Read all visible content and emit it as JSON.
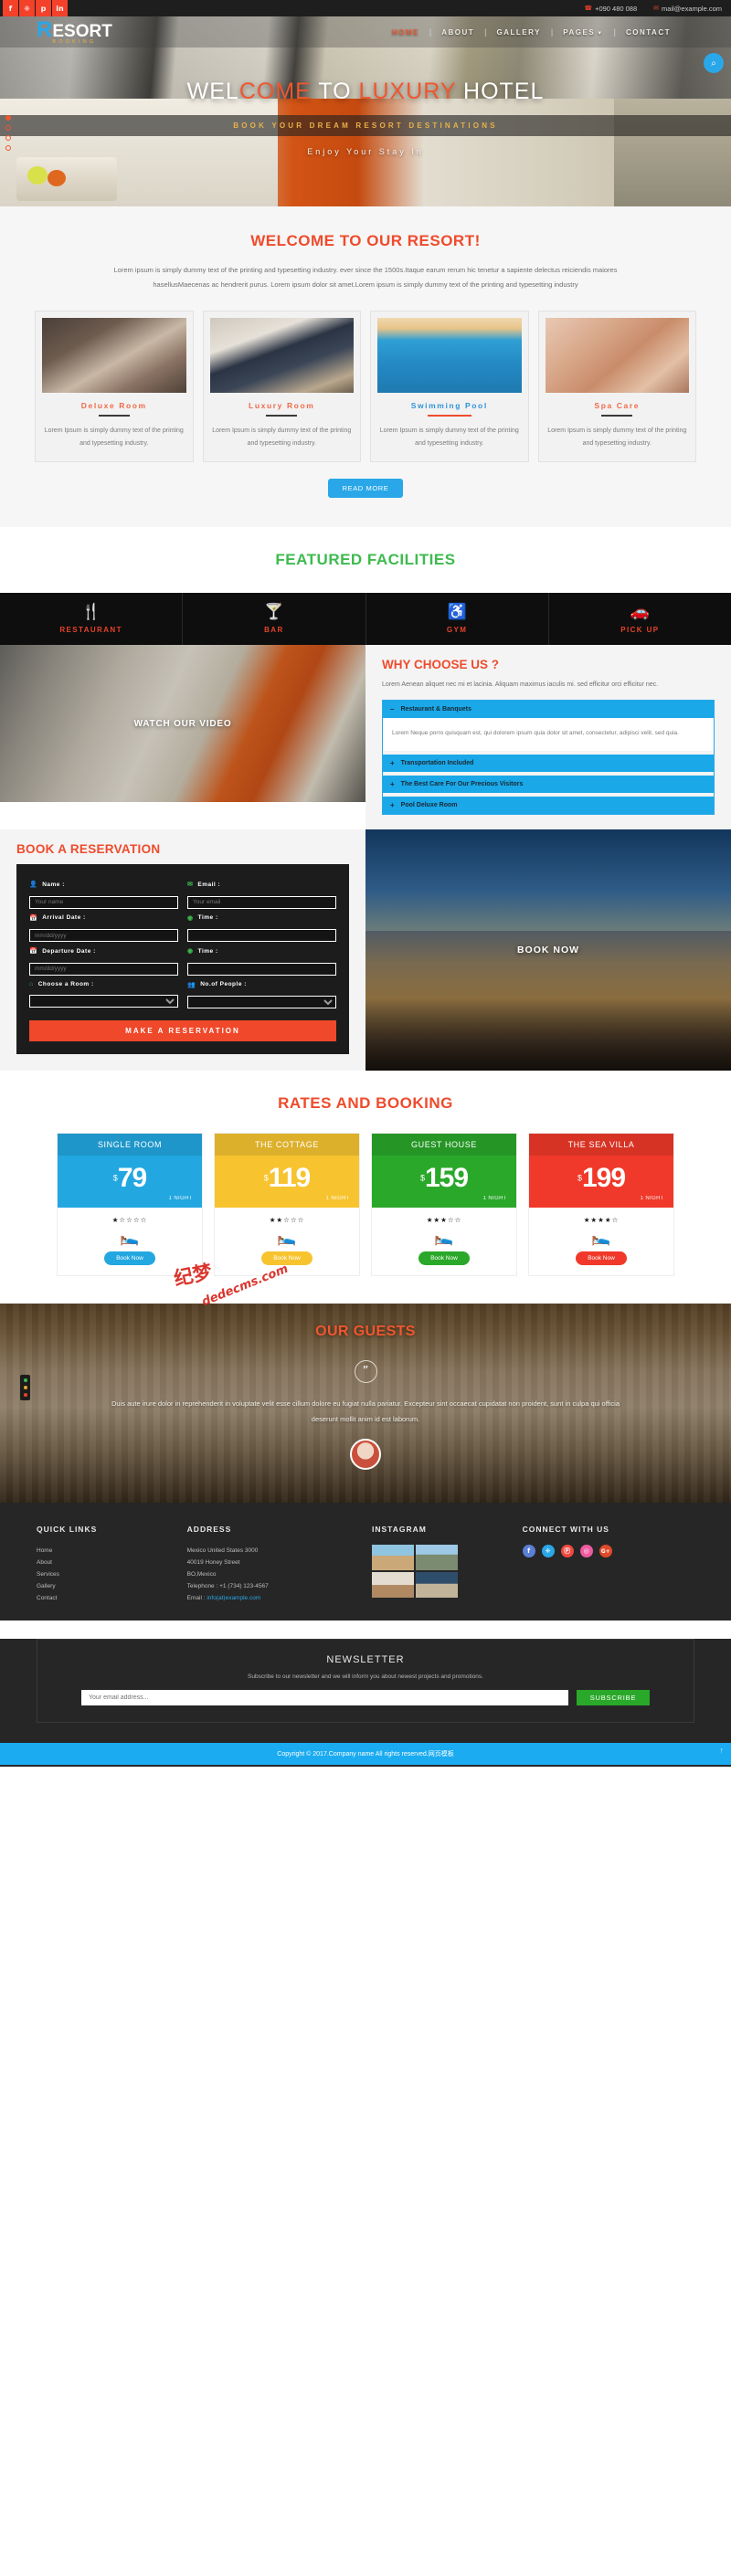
{
  "topbar": {
    "social": [
      {
        "name": "facebook",
        "glyph": "f"
      },
      {
        "name": "twitter",
        "glyph": "❈"
      },
      {
        "name": "pinterest",
        "glyph": "p"
      },
      {
        "name": "linkedin",
        "glyph": "in"
      }
    ],
    "phone_icon": "☎",
    "phone": "+090 480 088",
    "mail_icon": "✉",
    "email": "mail@example.com"
  },
  "header": {
    "logo_r": "R",
    "logo_rest": "ESORT",
    "logo_sub": "BOOKING",
    "nav": [
      {
        "label": "HOME",
        "active": true,
        "caret": false
      },
      {
        "label": "ABOUT",
        "active": false,
        "caret": false
      },
      {
        "label": "GALLERY",
        "active": false,
        "caret": false
      },
      {
        "label": "PAGES",
        "active": false,
        "caret": true
      },
      {
        "label": "CONTACT",
        "active": false,
        "caret": false
      }
    ],
    "search_icon": "⌕"
  },
  "hero": {
    "title_a": "WEL",
    "title_b": "COME",
    "title_c": " TO ",
    "title_d": "LUXURY",
    "title_e": " HOTEL",
    "subtitle": "BOOK YOUR DREAM RESORT DESTINATIONS",
    "tagline": "Enjoy Your Stay In",
    "dots": 4
  },
  "welcome": {
    "title": "WELCOME TO OUR RESORT!",
    "text": "Lorem ipsum is simply dummy text of the printing and typesetting industry. ever since the 1500s.Itaque earum rerum hic tenetur a sapiente delectus reiciendis maiores hasellusMaecenas ac hendrerit purus. Lorem ipsum dolor sit amet.Lorem ipsum is simply dummy text of the printing and typesetting industry",
    "cards": [
      {
        "title": "Deluxe Room",
        "text": "Lorem Ipsum is simply dummy text of the printing and typesetting industry.",
        "accent": "orange",
        "rule": "dark"
      },
      {
        "title": "Luxury Room",
        "text": "Lorem Ipsum is simply dummy text of the printing and typesetting industry.",
        "accent": "orange",
        "rule": "dark"
      },
      {
        "title": "Swimming Pool",
        "text": "Lorem Ipsum is simply dummy text of the printing and typesetting industry.",
        "accent": "blue",
        "rule": "orange"
      },
      {
        "title": "Spa Care",
        "text": "Lorem Ipsum is simply dummy text of the printing and typesetting industry.",
        "accent": "orange",
        "rule": "dark"
      }
    ],
    "read_more": "READ MORE"
  },
  "facilities": {
    "title": "FEATURED FACILITIES",
    "items": [
      {
        "label": "RESTAURANT",
        "icon": "🍴",
        "icon_name": "cutlery-icon"
      },
      {
        "label": "BAR",
        "icon": "🍸",
        "icon_name": "cocktail-icon"
      },
      {
        "label": "GYM",
        "icon": "♿",
        "icon_name": "gym-icon"
      },
      {
        "label": "PICK UP",
        "icon": "🚗",
        "icon_name": "car-icon"
      }
    ]
  },
  "video": {
    "label": "WATCH OUR VIDEO"
  },
  "why": {
    "title": "WHY CHOOSE US ?",
    "text": "Lorem Aenean aliquet nec mi et lacinia. Aliquam maximus iaculis mi. sed efficitur orci efficitur nec.",
    "accordion": [
      {
        "label": "Restaurant & Banquets",
        "sign": "–",
        "open": true,
        "body": "Lorem Neque porro quisquam est, qui dolorem ipsum quia dolor sit amet, consectetur, adipisci velit, sed quia."
      },
      {
        "label": "Transportation Included",
        "sign": "+",
        "open": false,
        "body": ""
      },
      {
        "label": "The Best Care For Our Precious Visitors",
        "sign": "+",
        "open": false,
        "body": ""
      },
      {
        "label": "Pool Deluxe Room",
        "sign": "+",
        "open": false,
        "body": ""
      }
    ]
  },
  "reservation": {
    "title": "BOOK A RESERVATION",
    "fields": [
      {
        "label": "Name :",
        "icon": "👤",
        "icon_name": "user-icon",
        "placeholder": "Your name",
        "type": "text"
      },
      {
        "label": "Email :",
        "icon": "✉",
        "icon_name": "envelope-icon",
        "placeholder": "Your email",
        "type": "text"
      },
      {
        "label": "Arrival Date :",
        "icon": "📅",
        "icon_name": "calendar-icon",
        "placeholder": "mm/dd/yyyy",
        "type": "text"
      },
      {
        "label": "Time :",
        "icon": "◉",
        "icon_name": "clock-icon",
        "placeholder": "",
        "type": "text"
      },
      {
        "label": "Departure Date :",
        "icon": "📅",
        "icon_name": "calendar-icon",
        "placeholder": "mm/dd/yyyy",
        "type": "text"
      },
      {
        "label": "Time :",
        "icon": "◉",
        "icon_name": "clock-icon",
        "placeholder": "",
        "type": "text"
      },
      {
        "label": "Choose a Room :",
        "icon": "⌂",
        "icon_name": "home-icon",
        "placeholder": "",
        "type": "select"
      },
      {
        "label": "No.of People :",
        "icon": "👥",
        "icon_name": "people-icon",
        "placeholder": "",
        "type": "select"
      }
    ],
    "submit": "MAKE A RESERVATION",
    "book_now_overlay": "BOOK NOW"
  },
  "rates": {
    "title": "RATES AND BOOKING",
    "cards": [
      {
        "name": "SINGLE ROOM",
        "currency": "$",
        "price": "79",
        "per": "1 NIGHT",
        "stars": "★☆☆☆☆",
        "button": "Book Now",
        "color": "#22a7e0"
      },
      {
        "name": "THE COTTAGE",
        "currency": "$",
        "price": "119",
        "per": "1 NIGHT",
        "stars": "★★☆☆☆",
        "button": "Book Now",
        "color": "#f7c430"
      },
      {
        "name": "GUEST HOUSE",
        "currency": "$",
        "price": "159",
        "per": "1 NIGHT",
        "stars": "★★★☆☆",
        "button": "Book Now",
        "color": "#2aa82a"
      },
      {
        "name": "THE SEA VILLA",
        "currency": "$",
        "price": "199",
        "per": "1 NIGHT",
        "stars": "★★★★☆",
        "button": "Book Now",
        "color": "#f0392a"
      }
    ],
    "bed_icon": "🛌"
  },
  "guests": {
    "title": "OUR GUESTS",
    "quote_icon": "”",
    "text": "Duis aute irure dolor in reprehenderit in voluptate velit esse cillum dolore eu fugiat nulla pariatur. Excepteur sint occaecat cupidatat non proident, sunt in culpa qui officia deserunt mollit anim id est laborum."
  },
  "footer": {
    "quick_links_title": "QUICK LINKS",
    "quick_links": [
      "Home",
      "About",
      "Services",
      "Gallery",
      "Contact"
    ],
    "address_title": "ADDRESS",
    "address_lines": [
      "Mexico United States 3000",
      "40019 Honey Street",
      "BO,Mexico",
      "Telephone : +1 (734) 123-4567"
    ],
    "email_label": "Email : ",
    "email_value": "info(at)example.com",
    "instagram_title": "INSTAGRAM",
    "connect_title": "CONNECT WITH US",
    "socials": [
      {
        "name": "facebook",
        "glyph": "f",
        "color": "#5b7fd4"
      },
      {
        "name": "twitter",
        "glyph": "❈",
        "color": "#29a7e8"
      },
      {
        "name": "pinterest",
        "glyph": "Ⓟ",
        "color": "#f0483f"
      },
      {
        "name": "dribbble",
        "glyph": "◎",
        "color": "#ef5aa0"
      },
      {
        "name": "google-plus",
        "glyph": "G+",
        "color": "#e04a2a"
      }
    ]
  },
  "newsletter": {
    "title": "NEWSLETTER",
    "subtitle": "Subscribe to our newsletter and we will inform you about newest projects and promotions.",
    "placeholder": "Your email address...",
    "button": "SUBSCRIBE"
  },
  "copyright": {
    "text": "Copyright © 2017.Company name All rights reserved.网页模板",
    "to_top_icon": "↑"
  },
  "watermark": {
    "line1": "纪梦",
    "line2": "dedecms.com"
  },
  "colors": {
    "orange": "#ef4b2c",
    "blue": "#29a7e8",
    "green": "#3dbb4e",
    "dark": "#262626"
  }
}
